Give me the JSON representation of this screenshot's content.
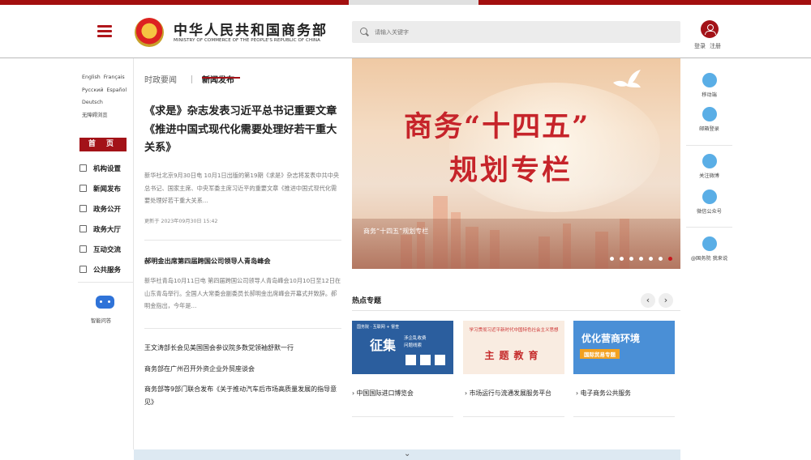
{
  "header": {
    "logo_cn": "中华人民共和国商务部",
    "logo_en": "MINISTRY OF COMMERCE OF THE PEOPLE'S REPUBLIC OF CHINA",
    "search_placeholder": "请输入关键字",
    "login": "登录",
    "register": "注册",
    "accent_color": "#a31218"
  },
  "languages": [
    "English",
    "Français",
    "Русский",
    "Español",
    "Deutsch",
    "无障碍浏览"
  ],
  "sidebar": {
    "home": "首 页",
    "items": [
      {
        "label": "机构设置",
        "icon": "grid-icon"
      },
      {
        "label": "新闻发布",
        "icon": "newspaper-icon"
      },
      {
        "label": "政务公开",
        "icon": "document-icon"
      },
      {
        "label": "政务大厅",
        "icon": "monitor-icon"
      },
      {
        "label": "互动交流",
        "icon": "chat-icon"
      },
      {
        "label": "公共服务",
        "icon": "service-icon"
      }
    ],
    "assistant": "智能问答"
  },
  "news": {
    "tabs": [
      "时政要闻",
      "新闻发布"
    ],
    "headline": "《求是》杂志发表习近平总书记重要文章《推进中国式现代化需要处理好若干重大关系》",
    "summary": "新华社北京9月30日电 10月1日出版的第19期《求是》杂志将发表中共中央总书记、国家主席、中央军委主席习近平的重要文章《推进中国式现代化需要处理好若干重大关系...",
    "meta": "更新于 2023年09月30日 15:42",
    "headline2": "郝明金出席第四届跨国公司领导人青岛峰会",
    "summary2": "新华社青岛10月11日电 第四届跨国公司领导人青岛峰会10月10日至12日在山东青岛举行。全国人大常委会副委员长郝明金出席峰会开幕式并致辞。郝明金指出，今年是...",
    "list": [
      "王文涛部长会见美国国会参议院多数党领袖舒默一行",
      "商务部在广州召开外资企业外贸座谈会",
      "商务部等9部门联合发布《关于推动汽车后市场高质量发展的指导意见》"
    ]
  },
  "banner": {
    "line1": "商务“十四五”",
    "line2": "规划专栏",
    "caption": "商务“十四五”规划专栏",
    "slide_count": 7,
    "active_slide": 7
  },
  "hot": {
    "title": "热点专题",
    "prev": "‹",
    "next": "›",
    "card1": {
      "tag": "国务院 · 互联网 + 督查",
      "big": "征集",
      "sub1": "涉企乱收费",
      "sub2": "问题线索"
    },
    "card2": {
      "top": "学习贯彻习近平新时代中国特色社会主义思想",
      "big": "主题教育"
    },
    "card3": {
      "big": "优化营商环境",
      "tag": "国际贸易专题"
    },
    "captions": [
      "中国国际进口博览会",
      "市场运行与流通发展服务平台",
      "电子商务公共服务"
    ]
  },
  "right": {
    "mobile": "移动端",
    "mail": "邮箱登录",
    "weibo": "关注微博",
    "wechat": "微信公众号",
    "gwy": "@国务院 我来说"
  }
}
